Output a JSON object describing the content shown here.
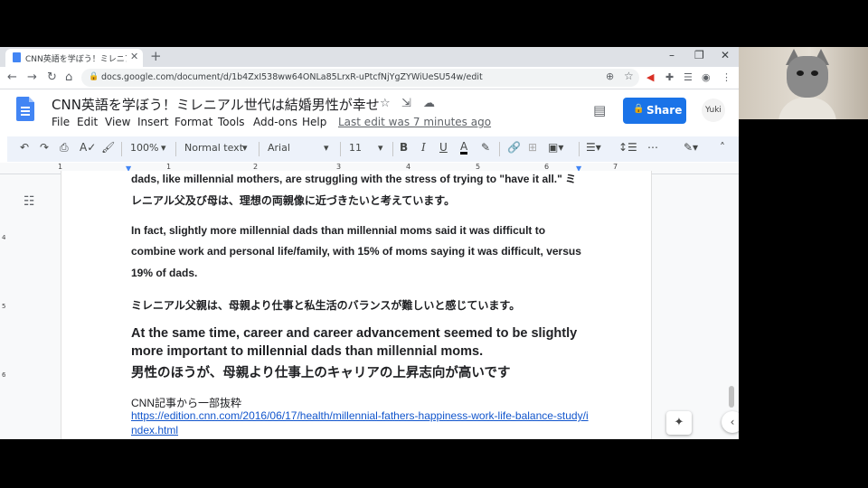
{
  "browser": {
    "tab_title": "CNN英語を学ぼう！ミレニアル世代は",
    "tab_close": "✕",
    "new_tab": "+",
    "url": "docs.google.com/document/d/1b4ZxI538ww64ONLa85LrxR-uPtcfNjYgZYWiUeSU54w/edit",
    "window_controls": [
      "–",
      "❐",
      "✕"
    ]
  },
  "docs": {
    "title": "CNN英語を学ぼう！ミレニアル世代は結婚男性が幸せ",
    "menu": [
      "File",
      "Edit",
      "View",
      "Insert",
      "Format",
      "Tools",
      "Add-ons",
      "Help"
    ],
    "last_edit": "Last edit was 7 minutes ago",
    "share_label": "Share",
    "avatar_text": "Yuki"
  },
  "toolbar": {
    "zoom": "100%",
    "style": "Normal text",
    "font": "Arial",
    "size": "11"
  },
  "ruler": {
    "numbers": [
      "1",
      "1",
      "2",
      "3",
      "4",
      "5",
      "6",
      "7"
    ],
    "vertical_numbers": [
      "4",
      "5",
      "6"
    ]
  },
  "content": {
    "p1_line1": "dads, like millennial mothers, are struggling with the stress of trying to \"have it all.\"  ミ",
    "p1_line2": "レニアル父及び母は、理想の両親像に近づきたいと考えています。",
    "p2_line1": "In fact, slightly more millennial dads than millennial moms said it was difficult to",
    "p2_line2": "combine work and personal life/family, with 15% of moms saying it was difficult, versus",
    "p2_line3": "19% of dads.",
    "p3": "ミレニアル父親は、母親より仕事と私生活のバランスが難しいと感じています。",
    "p4_line1": "At the same time, career and career advancement seemed to be slightly",
    "p4_line2": "more important to millennial dads than millennial moms.",
    "p4_line3": "男性のほうが、母親より仕事上のキャリアの上昇志向が高いです",
    "p5": "CNN記事から一部抜粋",
    "link_line1": "https://edition.cnn.com/2016/06/17/health/millennial-fathers-happiness-work-life-balance-study/i",
    "link_line2": "ndex.html"
  },
  "colors": {
    "share": "#1a73e8",
    "toolbar_bg": "#edf2fa",
    "link": "#1155cc",
    "text_color_underline": "#000000"
  }
}
